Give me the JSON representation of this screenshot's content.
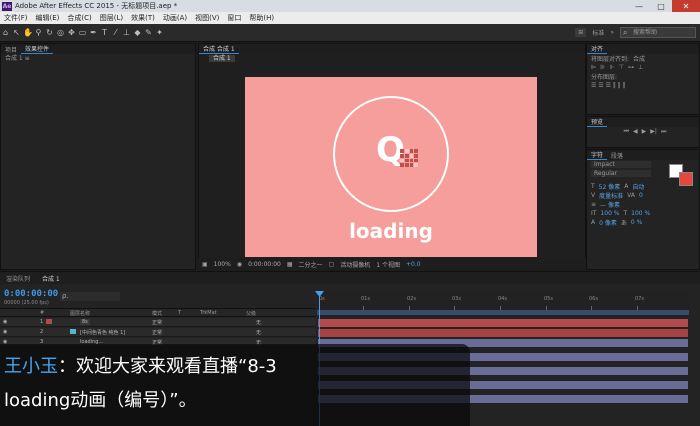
{
  "window": {
    "title": "Adobe After Effects CC 2015 - 无标题项目.aep *",
    "app_icon": "Ae",
    "controls": [
      "—",
      "□",
      "✕"
    ]
  },
  "menu": [
    "文件(F)",
    "编辑(E)",
    "合成(C)",
    "图层(L)",
    "效果(T)",
    "动画(A)",
    "视图(V)",
    "窗口",
    "帮助(H)"
  ],
  "toolbar": {
    "workspace": "标准",
    "search_placeholder": "搜索帮助"
  },
  "project_panel": {
    "tab": "项目",
    "tab2": "效果控件",
    "title": "合成 1 ≡"
  },
  "comp_panel": {
    "tab": "合成 合成 1",
    "label": "合成 1"
  },
  "comp_content": {
    "glyph": "Q",
    "text": "loading"
  },
  "viewer_bar": {
    "zoom": "100%",
    "timecode": "0:00:00:00",
    "resolution": "二分之一",
    "camera": "活动摄像机",
    "views": "1 个视图",
    "offset": "+0.0"
  },
  "right_panels": {
    "align_tab": "对齐",
    "align_label": "将图层对齐到:",
    "align_target": "合成",
    "distribute_label": "分布图层:",
    "preview_tab": "预览",
    "character_tab": "字符",
    "paragraph_tab": "段落",
    "font": "Impact",
    "style": "Regular",
    "size": "52 像素",
    "leading": "自动",
    "kerning": "度量标准",
    "tracking": "0",
    "stroke_width": "— 像素",
    "scale_v": "100 %",
    "scale_h": "100 %",
    "baseline": "0 像素",
    "tsume": "0 %"
  },
  "timeline": {
    "tab_render": "渲染队列",
    "tab_comp": "合成 1",
    "timecode": "0:00:00:00",
    "fps": "00000 (25.00 fps)",
    "search": "ρ.",
    "columns": [
      "#",
      "图层名称",
      "模式",
      "T",
      "TrkMat",
      "父级"
    ],
    "layers": [
      {
        "num": "1",
        "name": "8s",
        "mode": "正常",
        "parent": "无",
        "color": "#b24c4c"
      },
      {
        "num": "2",
        "name": "[中间色青色 纯色 1]",
        "mode": "正常",
        "parent": "无",
        "color": "#59b3c9"
      },
      {
        "num": "3",
        "name": "loading...",
        "mode": "正常",
        "parent": "无",
        "color": "#b24c4c"
      }
    ],
    "ruler_labels": [
      "0s",
      "01s",
      "02s",
      "03s",
      "04s",
      "05s",
      "06s",
      "07s"
    ]
  },
  "caption": {
    "speaker": "王小玉",
    "line1": "：欢迎大家来观看直播“8-3",
    "line2": "loading动画（编号）”。"
  },
  "colors": {
    "accent": "#2f8ad8",
    "comp_bg": "#f59e9b",
    "panel": "#232323"
  }
}
